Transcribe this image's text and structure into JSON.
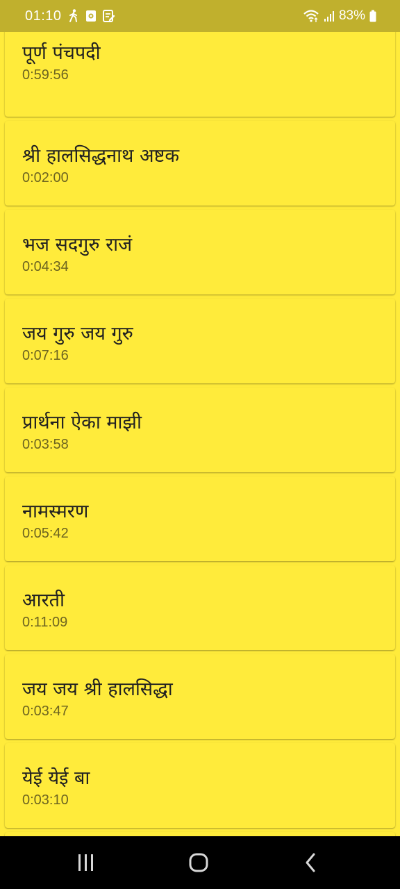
{
  "status_bar": {
    "time": "01:10",
    "battery": "83%",
    "icons": [
      "walking-icon",
      "screen-record-icon",
      "notes-icon",
      "wifi-icon",
      "signal-icon",
      "battery-icon"
    ]
  },
  "tracks": [
    {
      "title": "पूर्ण पंचपदी",
      "duration": "0:59:56"
    },
    {
      "title": "श्री हालसिद्धनाथ अष्टक",
      "duration": "0:02:00"
    },
    {
      "title": "भज सदगुरु राजं",
      "duration": "0:04:34"
    },
    {
      "title": "जय गुरु जय गुरु",
      "duration": "0:07:16"
    },
    {
      "title": "प्रार्थना ऐका माझी",
      "duration": "0:03:58"
    },
    {
      "title": "नामस्मरण",
      "duration": "0:05:42"
    },
    {
      "title": "आरती",
      "duration": "0:11:09"
    },
    {
      "title": "जय जय श्री हालसिद्धा",
      "duration": "0:03:47"
    },
    {
      "title": "येई येई बा",
      "duration": "0:03:10"
    }
  ],
  "navigation": {
    "recents_icon": "recent-apps-icon",
    "home_icon": "home-icon",
    "back_icon": "back-icon"
  },
  "colors": {
    "status_bar": "#c0b02d",
    "background": "#ffeb3b",
    "title_text": "#212121",
    "duration_text": "#6d6420",
    "nav_bar": "#000000"
  }
}
